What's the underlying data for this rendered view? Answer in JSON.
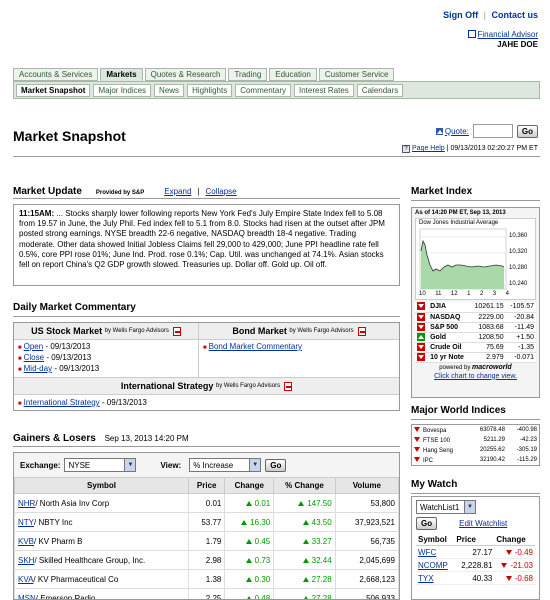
{
  "header": {
    "sign_off": "Sign Off",
    "separator": "|",
    "contact_us": "Contact us",
    "financial_advisor": "Financial Advisor",
    "user_name": "JAHE DOE"
  },
  "tabs": [
    "Accounts & Services",
    "Markets",
    "Quotes & Research",
    "Trading",
    "Education",
    "Customer Service"
  ],
  "subtabs": [
    "Market Snapshot",
    "Major Indices",
    "News",
    "Highlights",
    "Commentary",
    "Interest Rates",
    "Calendars"
  ],
  "page": {
    "title": "Market Snapshot",
    "quote_label": "Quote:",
    "quote_value": "",
    "go": "Go",
    "help": "Page Help",
    "timestamp": "09/13/2013 02:20:27 PM ET"
  },
  "market_update": {
    "title": "Market Update",
    "provided_by": "Provided by S&P",
    "expand": "Expand",
    "collapse": "Collapse",
    "time": "11:15AM:",
    "text": " ... Stocks sharply lower following reports New York Fed's July Empire State Index fell to 5.08 from 19.57 in June, the July Phil. Fed index fell to 5.1 from 8.0. Stocks had risen at the outset after JPM posted strong earnings. NYSE breadth 22-6 negative, NASDAQ breadth 18-4 negative. Trading moderate. Other data showed Initial Jobless Claims fell 29,000 to 429,000; June PPI headline rate fell 0.5%, core PPI rose 01%; June Ind. Prod. rose 0.1%; Cap. Util. was unchanged at 74.1%. Asian stocks fell on report China's Q2 GDP growth slowed. Treasuries up. Dollar off. Gold up. Oil off."
  },
  "daily_commentary": {
    "title": "Daily Market Commentary",
    "us_stock": "US Stock Market",
    "by_wf": "by Wells Fargo Advisors",
    "bond_market": "Bond Market",
    "bond_link": "Bond Market Commentary",
    "us_items": [
      {
        "link": "Open",
        "date": "- 09/13/2013"
      },
      {
        "link": "Close",
        "date": "- 09/13/2013"
      },
      {
        "link": "Mid-day",
        "date": "- 09/13/2013"
      }
    ],
    "intl": "International Strategy",
    "intl_link": "International Strategy",
    "intl_date": "- 09/13/2013"
  },
  "gainers": {
    "title": "Gainers & Losers",
    "date": "Sep 13, 2013 14:20 PM",
    "exchange_label": "Exchange:",
    "exchange_value": "NYSE",
    "view_label": "View:",
    "view_value": "% Increase",
    "go": "Go",
    "columns": [
      "Symbol",
      "Price",
      "Change",
      "% Change",
      "Volume"
    ],
    "rows": [
      {
        "sym": "NHR",
        "name": "/ North Asia Inv Corp",
        "price": "0.01",
        "change": "0.01",
        "pct": "147.50",
        "vol": "53,800"
      },
      {
        "sym": "NTY",
        "name": "/ NBTY Inc",
        "price": "53.77",
        "change": "16.30",
        "pct": "43.50",
        "vol": "37,923,521"
      },
      {
        "sym": "KVB",
        "name": "/ KV Pharm B",
        "price": "1.79",
        "change": "0.45",
        "pct": "33.27",
        "vol": "56,735"
      },
      {
        "sym": "SKH",
        "name": "/ Skilled Healthcare Group, Inc.",
        "price": "2.98",
        "change": "0.73",
        "pct": "32.44",
        "vol": "2,045,699"
      },
      {
        "sym": "KVA",
        "name": "/ KV Pharmaceutical Co",
        "price": "1.38",
        "change": "0.30",
        "pct": "27.28",
        "vol": "2,668,123"
      },
      {
        "sym": "MSN",
        "name": "/ Emerson Radio",
        "price": "2.25",
        "change": "0.48",
        "pct": "27.28",
        "vol": "506,933"
      }
    ]
  },
  "market_index": {
    "title": "Market Index",
    "as_of": "As of 14:20 PM ET, Sep 13, 2013",
    "chart_title": "Dow Jones Industrial Average",
    "y_ticks": [
      "10,360",
      "10,320",
      "10,280",
      "10,240"
    ],
    "x_ticks": [
      "10",
      "11",
      "12",
      "1",
      "2",
      "3",
      "4"
    ],
    "rows": [
      {
        "name": "DJIA",
        "value": "10261.15",
        "change": "-105.57",
        "dir": "down"
      },
      {
        "name": "NASDAQ",
        "value": "2229.00",
        "change": "-20.84",
        "dir": "down"
      },
      {
        "name": "S&P 500",
        "value": "1083.68",
        "change": "-11.49",
        "dir": "down"
      },
      {
        "name": "Gold",
        "value": "1208.50",
        "change": "+1.50",
        "dir": "up"
      },
      {
        "name": "Crude Oil",
        "value": "75.69",
        "change": "-1.35",
        "dir": "down"
      },
      {
        "name": "10 yr Note",
        "value": "2.979",
        "change": "-0.071",
        "dir": "down"
      }
    ],
    "powered_by": "powered by",
    "powered_brand": "macroworld",
    "click_chart": "Click chart to change view."
  },
  "world_indices": {
    "title": "Major World Indices",
    "rows": [
      {
        "name": "Bovespa",
        "value": "63078.48",
        "change": "-400.98"
      },
      {
        "name": "FTSE 100",
        "value": "5211.29",
        "change": "-42.23"
      },
      {
        "name": "Hang Seng",
        "value": "20255.62",
        "change": "-305.19"
      },
      {
        "name": "IPC",
        "value": "32190.42",
        "change": "-115.29"
      }
    ]
  },
  "my_watch": {
    "title": "My Watch",
    "list_value": "WatchList1",
    "go": "Go",
    "edit": "Edit Watchlist",
    "columns": [
      "Symbol",
      "Price",
      "Change"
    ],
    "rows": [
      {
        "sym": "WFC",
        "price": "27.17",
        "change": "-0.49"
      },
      {
        "sym": "NCOMP",
        "price": "2,228.81",
        "change": "-21.03"
      },
      {
        "sym": "TYX",
        "price": "40.33",
        "change": "-0.68"
      }
    ]
  },
  "colors": {
    "tab_bg": "#dde7dd",
    "link": "#003399",
    "up": "#009900",
    "down": "#cc0000"
  }
}
